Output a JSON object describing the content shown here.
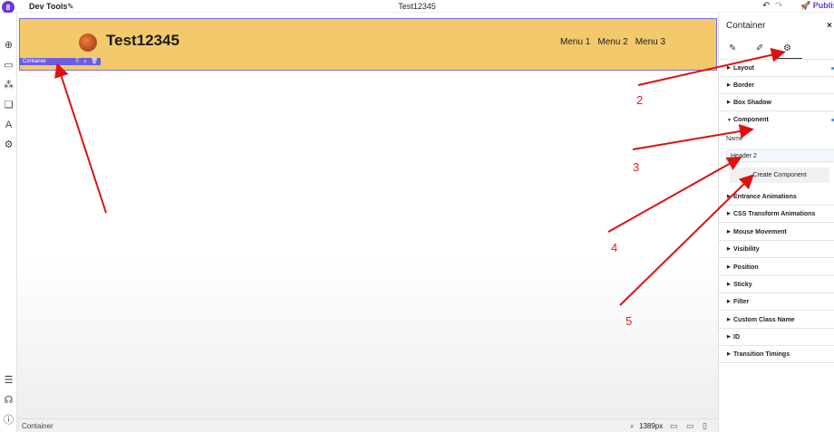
{
  "topbar": {
    "logo_badge": "8",
    "app_title": "Dev Tools",
    "page_title": "Test12345",
    "publish_label": "Publish"
  },
  "rail": {
    "icons": [
      "add-icon",
      "layout-icon",
      "components-icon",
      "pages-icon",
      "typography-icon",
      "settings-icon",
      "layers-icon",
      "support-icon",
      "info-icon"
    ]
  },
  "canvas": {
    "site_title": "Test12345",
    "menu": [
      "Menu 1",
      "Menu 2",
      "Menu 3"
    ],
    "container_tag": "Container",
    "header_color": "#f2c96b",
    "selection_color": "#6b5ce7"
  },
  "statusbar": {
    "selected_label": "Container",
    "zoom_value": "1389px"
  },
  "panel": {
    "title": "Container",
    "sections": [
      {
        "label": "Layout",
        "expanded": false
      },
      {
        "label": "Border",
        "expanded": false
      },
      {
        "label": "Box Shadow",
        "expanded": false
      },
      {
        "label": "Component",
        "expanded": true
      },
      {
        "label": "Entrance Animations",
        "expanded": false
      },
      {
        "label": "CSS Transform Animations",
        "expanded": false
      },
      {
        "label": "Mouse Movement",
        "expanded": false
      },
      {
        "label": "Visibility",
        "expanded": false
      },
      {
        "label": "Position",
        "expanded": false
      },
      {
        "label": "Sticky",
        "expanded": false
      },
      {
        "label": "Filter",
        "expanded": false
      },
      {
        "label": "Custom Class Name",
        "expanded": false
      },
      {
        "label": "ID",
        "expanded": false
      },
      {
        "label": "Transition Timings",
        "expanded": false
      }
    ],
    "component": {
      "name_label": "Name",
      "name_value": "Header 2",
      "create_label": "Create Component"
    }
  },
  "annotations": {
    "numbers": [
      "2",
      "3",
      "4",
      "5"
    ],
    "color": "#dd1111"
  }
}
